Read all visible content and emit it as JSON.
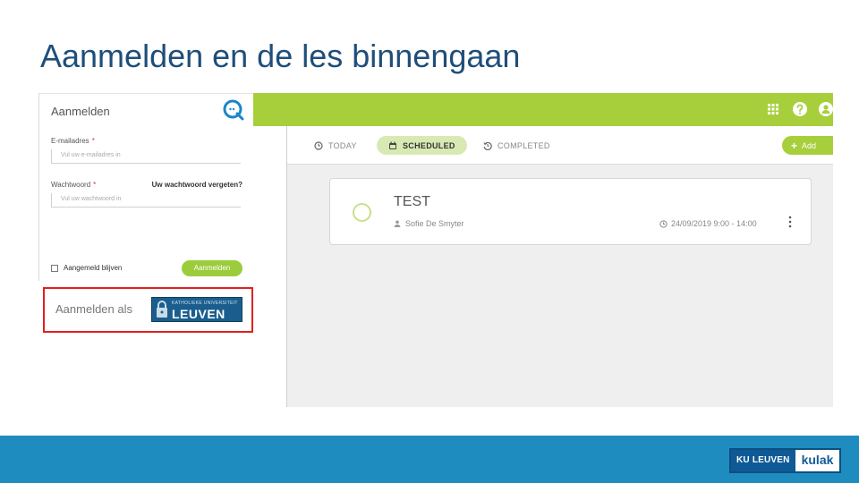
{
  "slide": {
    "title": "Aanmelden en de les binnengaan"
  },
  "login": {
    "title": "Aanmelden",
    "email_label": "E-mailadres",
    "email_required": "*",
    "email_placeholder": "Vul uw e-mailadres in",
    "password_label": "Wachtwoord",
    "password_required": "*",
    "password_placeholder": "Vul uw wachtwoord in",
    "forgot_link": "Uw wachtwoord vergeten?",
    "remember_label": "Aangemeld blijven",
    "submit_label": "Aanmelden"
  },
  "signin_as": {
    "label": "Aanmelden als",
    "provider_small": "KATHOLIEKE UNIVERSITEIT",
    "provider_big": "LEUVEN"
  },
  "app": {
    "accent": "#a7cf3c",
    "top_icons": [
      "apps-grid-icon",
      "help-icon",
      "user-icon"
    ],
    "tabs": [
      {
        "label": "TODAY",
        "icon": "clock-icon",
        "active": false
      },
      {
        "label": "SCHEDULED",
        "icon": "calendar-icon",
        "active": true
      },
      {
        "label": "COMPLETED",
        "icon": "history-icon",
        "active": false
      }
    ],
    "add_label": "Add",
    "session": {
      "title": "TEST",
      "host": "Sofie De Smyter",
      "time": "24/09/2019 9:00 - 14:00"
    }
  },
  "footer": {
    "brand": "KU LEUVEN",
    "campus": "kulak",
    "color": "#1f8cc0"
  }
}
